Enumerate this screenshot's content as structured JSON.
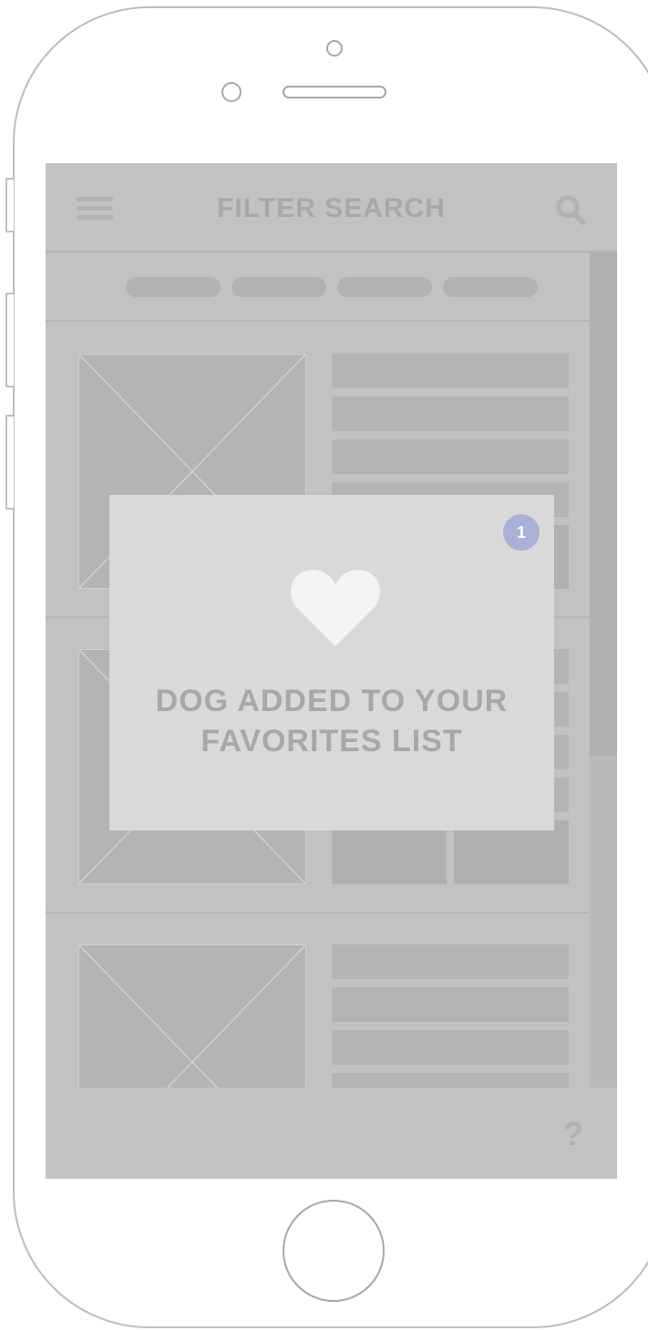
{
  "header": {
    "title": "FILTER SEARCH"
  },
  "filters": {
    "chips": [
      "",
      "",
      "",
      ""
    ]
  },
  "modal": {
    "badge_count": "1",
    "message_line1": "DOG ADDED TO YOUR",
    "message_line2": "FAVORITES LIST",
    "icon": "heart-icon"
  },
  "bottom_bar": {
    "help_label": "?"
  },
  "colors": {
    "screen_bg": "#c2c2c2",
    "modal_bg": "#d9d9d9",
    "badge": "#a9b1d8",
    "heart": "#f4f4f4"
  }
}
